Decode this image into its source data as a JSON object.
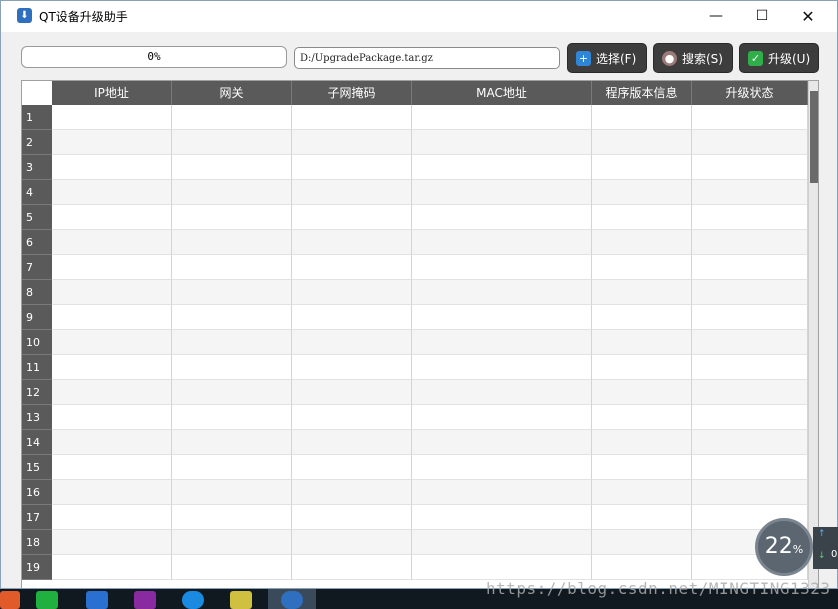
{
  "window": {
    "title": "QT设备升级助手"
  },
  "toolbar": {
    "progress_text": "0%",
    "progress_value": 0,
    "path_value": "D:/UpgradePackage.tar.gz",
    "select_label": "选择(F)",
    "search_label": "搜索(S)",
    "upgrade_label": "升级(U)"
  },
  "table": {
    "headers": [
      "IP地址",
      "网关",
      "子网掩码",
      "MAC地址",
      "程序版本信息",
      "升级状态"
    ],
    "row_numbers": [
      "1",
      "2",
      "3",
      "4",
      "5",
      "6",
      "7",
      "8",
      "9",
      "10",
      "11",
      "12",
      "13",
      "14",
      "15",
      "16",
      "17",
      "18",
      "19"
    ]
  },
  "overlay": {
    "watermark": "https://blog.csdn.net/MINGTING1323",
    "gauge_value": "22",
    "gauge_unit": "%",
    "side_value": "0"
  },
  "colors": {
    "header_bg": "#5a5a5a",
    "accent": "#2f86d6",
    "ok": "#2fae4a"
  }
}
